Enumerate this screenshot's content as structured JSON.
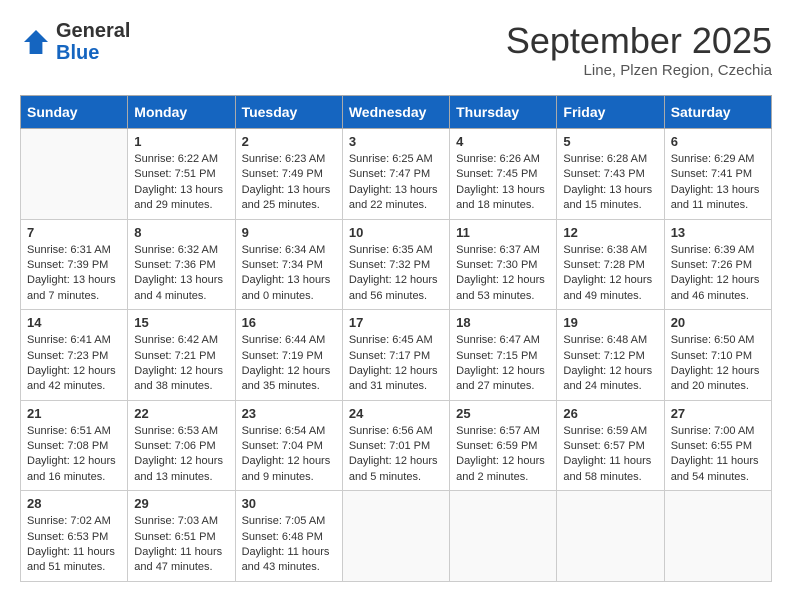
{
  "header": {
    "logo_general": "General",
    "logo_blue": "Blue",
    "month_title": "September 2025",
    "location": "Line, Plzen Region, Czechia"
  },
  "days_of_week": [
    "Sunday",
    "Monday",
    "Tuesday",
    "Wednesday",
    "Thursday",
    "Friday",
    "Saturday"
  ],
  "weeks": [
    [
      {
        "day": "",
        "sunrise": "",
        "sunset": "",
        "daylight": "",
        "empty": true
      },
      {
        "day": "1",
        "sunrise": "Sunrise: 6:22 AM",
        "sunset": "Sunset: 7:51 PM",
        "daylight": "Daylight: 13 hours and 29 minutes."
      },
      {
        "day": "2",
        "sunrise": "Sunrise: 6:23 AM",
        "sunset": "Sunset: 7:49 PM",
        "daylight": "Daylight: 13 hours and 25 minutes."
      },
      {
        "day": "3",
        "sunrise": "Sunrise: 6:25 AM",
        "sunset": "Sunset: 7:47 PM",
        "daylight": "Daylight: 13 hours and 22 minutes."
      },
      {
        "day": "4",
        "sunrise": "Sunrise: 6:26 AM",
        "sunset": "Sunset: 7:45 PM",
        "daylight": "Daylight: 13 hours and 18 minutes."
      },
      {
        "day": "5",
        "sunrise": "Sunrise: 6:28 AM",
        "sunset": "Sunset: 7:43 PM",
        "daylight": "Daylight: 13 hours and 15 minutes."
      },
      {
        "day": "6",
        "sunrise": "Sunrise: 6:29 AM",
        "sunset": "Sunset: 7:41 PM",
        "daylight": "Daylight: 13 hours and 11 minutes."
      }
    ],
    [
      {
        "day": "7",
        "sunrise": "Sunrise: 6:31 AM",
        "sunset": "Sunset: 7:39 PM",
        "daylight": "Daylight: 13 hours and 7 minutes."
      },
      {
        "day": "8",
        "sunrise": "Sunrise: 6:32 AM",
        "sunset": "Sunset: 7:36 PM",
        "daylight": "Daylight: 13 hours and 4 minutes."
      },
      {
        "day": "9",
        "sunrise": "Sunrise: 6:34 AM",
        "sunset": "Sunset: 7:34 PM",
        "daylight": "Daylight: 13 hours and 0 minutes."
      },
      {
        "day": "10",
        "sunrise": "Sunrise: 6:35 AM",
        "sunset": "Sunset: 7:32 PM",
        "daylight": "Daylight: 12 hours and 56 minutes."
      },
      {
        "day": "11",
        "sunrise": "Sunrise: 6:37 AM",
        "sunset": "Sunset: 7:30 PM",
        "daylight": "Daylight: 12 hours and 53 minutes."
      },
      {
        "day": "12",
        "sunrise": "Sunrise: 6:38 AM",
        "sunset": "Sunset: 7:28 PM",
        "daylight": "Daylight: 12 hours and 49 minutes."
      },
      {
        "day": "13",
        "sunrise": "Sunrise: 6:39 AM",
        "sunset": "Sunset: 7:26 PM",
        "daylight": "Daylight: 12 hours and 46 minutes."
      }
    ],
    [
      {
        "day": "14",
        "sunrise": "Sunrise: 6:41 AM",
        "sunset": "Sunset: 7:23 PM",
        "daylight": "Daylight: 12 hours and 42 minutes."
      },
      {
        "day": "15",
        "sunrise": "Sunrise: 6:42 AM",
        "sunset": "Sunset: 7:21 PM",
        "daylight": "Daylight: 12 hours and 38 minutes."
      },
      {
        "day": "16",
        "sunrise": "Sunrise: 6:44 AM",
        "sunset": "Sunset: 7:19 PM",
        "daylight": "Daylight: 12 hours and 35 minutes."
      },
      {
        "day": "17",
        "sunrise": "Sunrise: 6:45 AM",
        "sunset": "Sunset: 7:17 PM",
        "daylight": "Daylight: 12 hours and 31 minutes."
      },
      {
        "day": "18",
        "sunrise": "Sunrise: 6:47 AM",
        "sunset": "Sunset: 7:15 PM",
        "daylight": "Daylight: 12 hours and 27 minutes."
      },
      {
        "day": "19",
        "sunrise": "Sunrise: 6:48 AM",
        "sunset": "Sunset: 7:12 PM",
        "daylight": "Daylight: 12 hours and 24 minutes."
      },
      {
        "day": "20",
        "sunrise": "Sunrise: 6:50 AM",
        "sunset": "Sunset: 7:10 PM",
        "daylight": "Daylight: 12 hours and 20 minutes."
      }
    ],
    [
      {
        "day": "21",
        "sunrise": "Sunrise: 6:51 AM",
        "sunset": "Sunset: 7:08 PM",
        "daylight": "Daylight: 12 hours and 16 minutes."
      },
      {
        "day": "22",
        "sunrise": "Sunrise: 6:53 AM",
        "sunset": "Sunset: 7:06 PM",
        "daylight": "Daylight: 12 hours and 13 minutes."
      },
      {
        "day": "23",
        "sunrise": "Sunrise: 6:54 AM",
        "sunset": "Sunset: 7:04 PM",
        "daylight": "Daylight: 12 hours and 9 minutes."
      },
      {
        "day": "24",
        "sunrise": "Sunrise: 6:56 AM",
        "sunset": "Sunset: 7:01 PM",
        "daylight": "Daylight: 12 hours and 5 minutes."
      },
      {
        "day": "25",
        "sunrise": "Sunrise: 6:57 AM",
        "sunset": "Sunset: 6:59 PM",
        "daylight": "Daylight: 12 hours and 2 minutes."
      },
      {
        "day": "26",
        "sunrise": "Sunrise: 6:59 AM",
        "sunset": "Sunset: 6:57 PM",
        "daylight": "Daylight: 11 hours and 58 minutes."
      },
      {
        "day": "27",
        "sunrise": "Sunrise: 7:00 AM",
        "sunset": "Sunset: 6:55 PM",
        "daylight": "Daylight: 11 hours and 54 minutes."
      }
    ],
    [
      {
        "day": "28",
        "sunrise": "Sunrise: 7:02 AM",
        "sunset": "Sunset: 6:53 PM",
        "daylight": "Daylight: 11 hours and 51 minutes."
      },
      {
        "day": "29",
        "sunrise": "Sunrise: 7:03 AM",
        "sunset": "Sunset: 6:51 PM",
        "daylight": "Daylight: 11 hours and 47 minutes."
      },
      {
        "day": "30",
        "sunrise": "Sunrise: 7:05 AM",
        "sunset": "Sunset: 6:48 PM",
        "daylight": "Daylight: 11 hours and 43 minutes."
      },
      {
        "day": "",
        "sunrise": "",
        "sunset": "",
        "daylight": "",
        "empty": true
      },
      {
        "day": "",
        "sunrise": "",
        "sunset": "",
        "daylight": "",
        "empty": true
      },
      {
        "day": "",
        "sunrise": "",
        "sunset": "",
        "daylight": "",
        "empty": true
      },
      {
        "day": "",
        "sunrise": "",
        "sunset": "",
        "daylight": "",
        "empty": true
      }
    ]
  ]
}
